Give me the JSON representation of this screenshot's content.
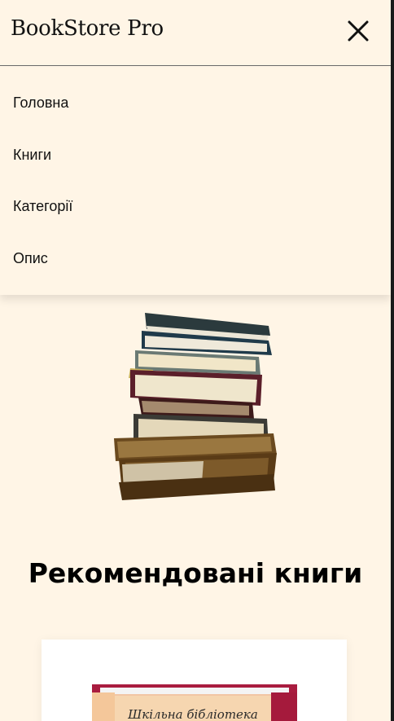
{
  "header": {
    "brand": "BookStore Pro",
    "close_icon": "close-icon"
  },
  "nav": {
    "items": [
      {
        "label": "Головна"
      },
      {
        "label": "Книги"
      },
      {
        "label": "Категорії"
      },
      {
        "label": "Опис"
      }
    ]
  },
  "hero": {
    "image": "stack-of-books-illustration"
  },
  "recommended": {
    "title": "Рекомендовані книги",
    "first_card": {
      "cover_title": "Шкільна бібліотека"
    }
  },
  "colors": {
    "background": "#fff5e6",
    "text": "#111111",
    "card": "#ffffff"
  }
}
